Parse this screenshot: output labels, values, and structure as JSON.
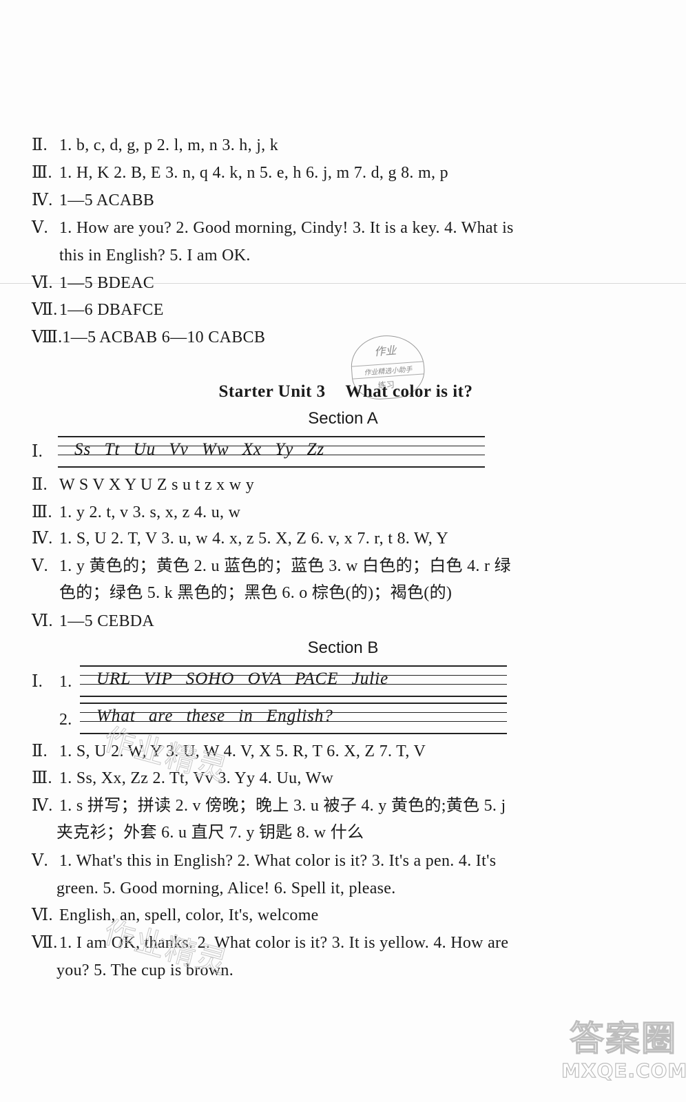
{
  "part1": {
    "lines": [
      {
        "num": "Ⅱ.",
        "text": "1. b,  c,  d,  g,  p    2. l,  m,  n    3. h,  j,  k"
      },
      {
        "num": "Ⅲ.",
        "text": "1. H,  K   2. B,  E   3. n,  q   4. k,  n   5. e,  h   6. j,  m   7. d,  g   8. m,  p"
      },
      {
        "num": "Ⅳ.",
        "text": "1—5  ACABB"
      },
      {
        "num": "Ⅴ.",
        "text": "1. How  are  you?   2. Good  morning,  Cindy!    3. It  is  a  key.    4. What  is"
      },
      {
        "num": "",
        "text": "this  in  English?    5. I  am  OK."
      },
      {
        "num": "Ⅵ.",
        "text": "1—5  BDEAC"
      },
      {
        "num": "Ⅶ.",
        "text": "1—6  DBAFCE"
      },
      {
        "num": "Ⅷ.",
        "text": "1—5  ACBAB    6—10  CABCB"
      }
    ]
  },
  "stamp": {
    "top": "作业",
    "middle": "作业精选小助手",
    "bottom": "练习"
  },
  "unit_title": {
    "unit": "Starter  Unit  3",
    "topic": "What  color  is  it?"
  },
  "section_a": {
    "heading": "Section  A",
    "writing_label": "Ⅰ.",
    "writing_text": "Ss  Tt  Uu  Vv  Ww   Xx  Yy  Zz",
    "lines": [
      {
        "num": "Ⅱ.",
        "text": "W    S    V    X    Y    U    Z    s    u    t    z    x    w    y"
      },
      {
        "num": "Ⅲ.",
        "text": "1. y    2. t,  v    3. s,  x,  z    4. u,  w"
      },
      {
        "num": "Ⅳ.",
        "text": "1. S,  U    2. T,  V    3. u,  w    4. x,  z    5. X,  Z    6. v,  x    7. r,  t  8. W,  Y"
      },
      {
        "num": "Ⅴ.",
        "text": "1. y   黄色的；黄色   2. u   蓝色的；蓝色   3. w   白色的；白色   4. r   绿"
      },
      {
        "num": "",
        "text": "色的；绿色   5. k   黑色的；黑色   6. o   棕色(的)；褐色(的)"
      },
      {
        "num": "Ⅵ.",
        "text": "1—5  CEBDA"
      }
    ]
  },
  "section_b": {
    "heading": "Section  B",
    "writing_label": "Ⅰ.",
    "writing": [
      {
        "num": "1.",
        "text": "URL  VIP  SOHO  OVA  PACE   Julie"
      },
      {
        "num": "2.",
        "text": "What  are  these  in  English?"
      }
    ],
    "lines": [
      {
        "num": "Ⅱ.",
        "text": "1. S,  U   2. W,  Y    3. U,  W    4. V,  X    5. R,  T    6. X,  Z    7. T,  V"
      },
      {
        "num": "Ⅲ.",
        "text": "1. Ss,  Xx,  Zz    2. Tt,  Vv    3. Yy    4. Uu,  Ww"
      },
      {
        "num": "Ⅳ.",
        "text": "1. s   拼写；拼读   2. v   傍晚；晚上   3. u   被子   4. y   黄色的;黄色   5. j"
      },
      {
        "num": "",
        "text": "夹克衫；外套   6. u   直尺   7. y   钥匙   8. w   什么"
      },
      {
        "num": "Ⅴ.",
        "text": "1. What's  this  in  English?   2. What  color  is  it?   3. It's  a  pen.   4. It's"
      },
      {
        "num": "",
        "text": "green.   5. Good  morning,  Alice!   6. Spell  it,  please."
      },
      {
        "num": "Ⅵ.",
        "text": "English,  an,  spell,  color,  It's,  welcome"
      },
      {
        "num": "Ⅶ.",
        "text": "1. I  am  OK,  thanks.   2. What  color  is  it?    3. It  is  yellow.    4. How  are"
      },
      {
        "num": "",
        "text": "you?    5. The  cup  is  brown."
      }
    ]
  },
  "watermarks": {
    "center_text": "作业精灵",
    "logo_cn": "答案圈",
    "logo_en": "MXQE.COM"
  }
}
